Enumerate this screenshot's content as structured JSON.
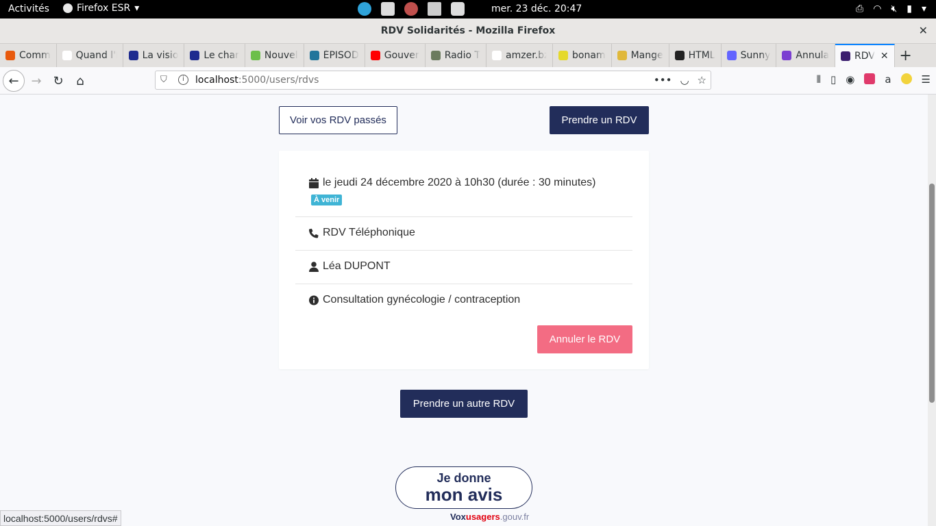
{
  "system_bar": {
    "activities": "Activités",
    "app_name": "Firefox ESR",
    "clock": "mer. 23 déc.  20:47"
  },
  "window": {
    "title": "RDV Solidarités - Mozilla Firefox"
  },
  "tabs": [
    {
      "label": "Comm",
      "color": "#e8590c"
    },
    {
      "label": "Quand l'É",
      "color": "#ffffff"
    },
    {
      "label": "La visio",
      "color": "#1e2b8f"
    },
    {
      "label": "Le char",
      "color": "#1e2b8f"
    },
    {
      "label": "Nouvel",
      "color": "#6cbf4a"
    },
    {
      "label": "ÉPISOD",
      "color": "#21759b"
    },
    {
      "label": "Gouver",
      "color": "#ff0000"
    },
    {
      "label": "Radio T",
      "color": "#6b7b5e"
    },
    {
      "label": "amzer.bzh",
      "color": "#ffffff"
    },
    {
      "label": "bonam",
      "color": "#e5d92b"
    },
    {
      "label": "Mange",
      "color": "#e0b83a"
    },
    {
      "label": "HTML",
      "color": "#222222"
    },
    {
      "label": "Sunny",
      "color": "#6364ff"
    },
    {
      "label": "Annula",
      "color": "#7b3fd1"
    },
    {
      "label": "RDV",
      "color": "#3b1e6e",
      "active": true
    }
  ],
  "address_bar": {
    "host": "localhost",
    "path": ":5000/users/rdvs"
  },
  "page": {
    "past_button": "Voir vos RDV passés",
    "take_button": "Prendre un RDV",
    "rdv": {
      "date": "le jeudi 24 décembre 2020 à 10h30 (durée : 30 minutes)",
      "badge": "À venir",
      "type": "RDV Téléphonique",
      "user": "Léa DUPONT",
      "motif": "Consultation gynécologie / contraception",
      "cancel_button": "Annuler le RDV"
    },
    "other_button": "Prendre un autre RDV",
    "avis_line1": "Je donne",
    "avis_line2": "mon avis",
    "vox1": "Vox",
    "vox2": "usagers",
    "vox3": ".gouv.fr"
  },
  "status_bar": "localhost:5000/users/rdvs#"
}
